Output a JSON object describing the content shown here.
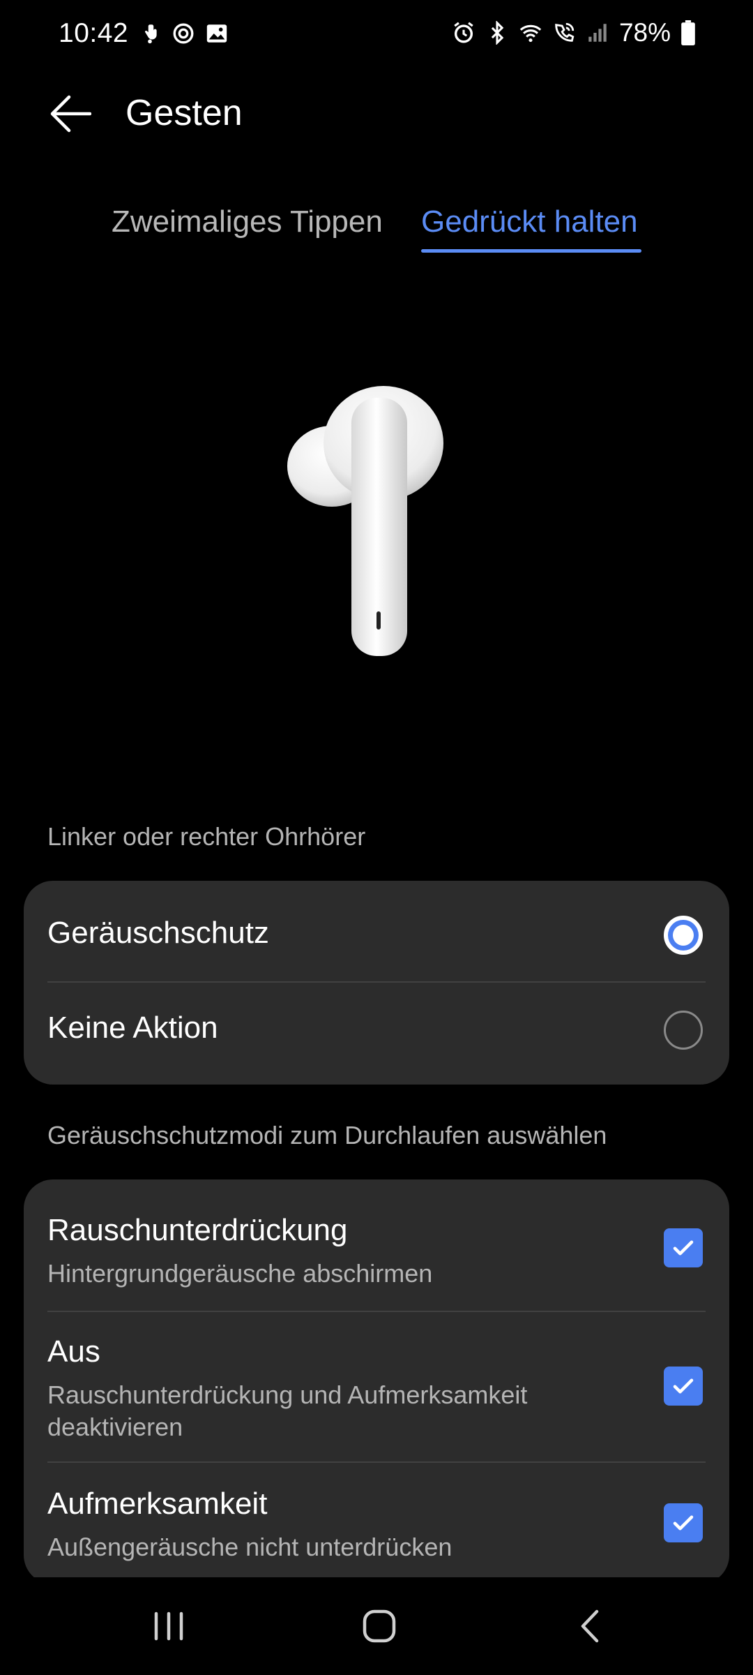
{
  "status_bar": {
    "time": "10:42",
    "battery": "78%",
    "left_icons": [
      "hand-icon",
      "refresh-icon",
      "image-icon"
    ],
    "right_icons": [
      "alarm-icon",
      "bluetooth-icon",
      "wifi-icon",
      "wifi-calling-icon",
      "signal-icon",
      "battery-icon"
    ]
  },
  "header": {
    "title": "Gesten",
    "back_icon": "arrow-left-icon"
  },
  "tabs": [
    {
      "label": "Zweimaliges Tippen",
      "selected": false
    },
    {
      "label": "Gedrückt halten",
      "selected": true
    }
  ],
  "accent_color": "#4a7ef1",
  "earbud_section": {
    "label": "Linker oder rechter Ohrhörer",
    "options": [
      {
        "label": "Geräuschschutz",
        "selected": true
      },
      {
        "label": "Keine Aktion",
        "selected": false
      }
    ]
  },
  "modes_section": {
    "label": "Geräuschschutzmodi zum Durchlaufen auswählen",
    "items": [
      {
        "title": "Rauschunterdrückung",
        "subtitle": "Hintergrundgeräusche abschirmen",
        "checked": true
      },
      {
        "title": "Aus",
        "subtitle": "Rauschunterdrückung und Aufmerksamkeit deaktivieren",
        "checked": true
      },
      {
        "title": "Aufmerksamkeit",
        "subtitle": "Außengeräusche nicht unterdrücken",
        "checked": true
      }
    ]
  },
  "nav_bar": {
    "buttons": [
      "recents-icon",
      "home-icon",
      "back-icon"
    ]
  }
}
